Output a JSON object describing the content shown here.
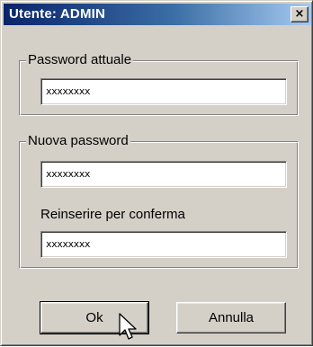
{
  "window": {
    "title": "Utente: ADMIN",
    "close_label": "×"
  },
  "current_password": {
    "group_label": "Password attuale",
    "value": "xxxxxxxx"
  },
  "new_password": {
    "group_label": "Nuova password",
    "value": "xxxxxxxx",
    "confirm_label": "Reinserire per conferma",
    "confirm_value": "xxxxxxxx"
  },
  "buttons": {
    "ok_label": "Ok",
    "cancel_label": "Annulla"
  },
  "cursor_icon": "arrow-pointer-icon"
}
